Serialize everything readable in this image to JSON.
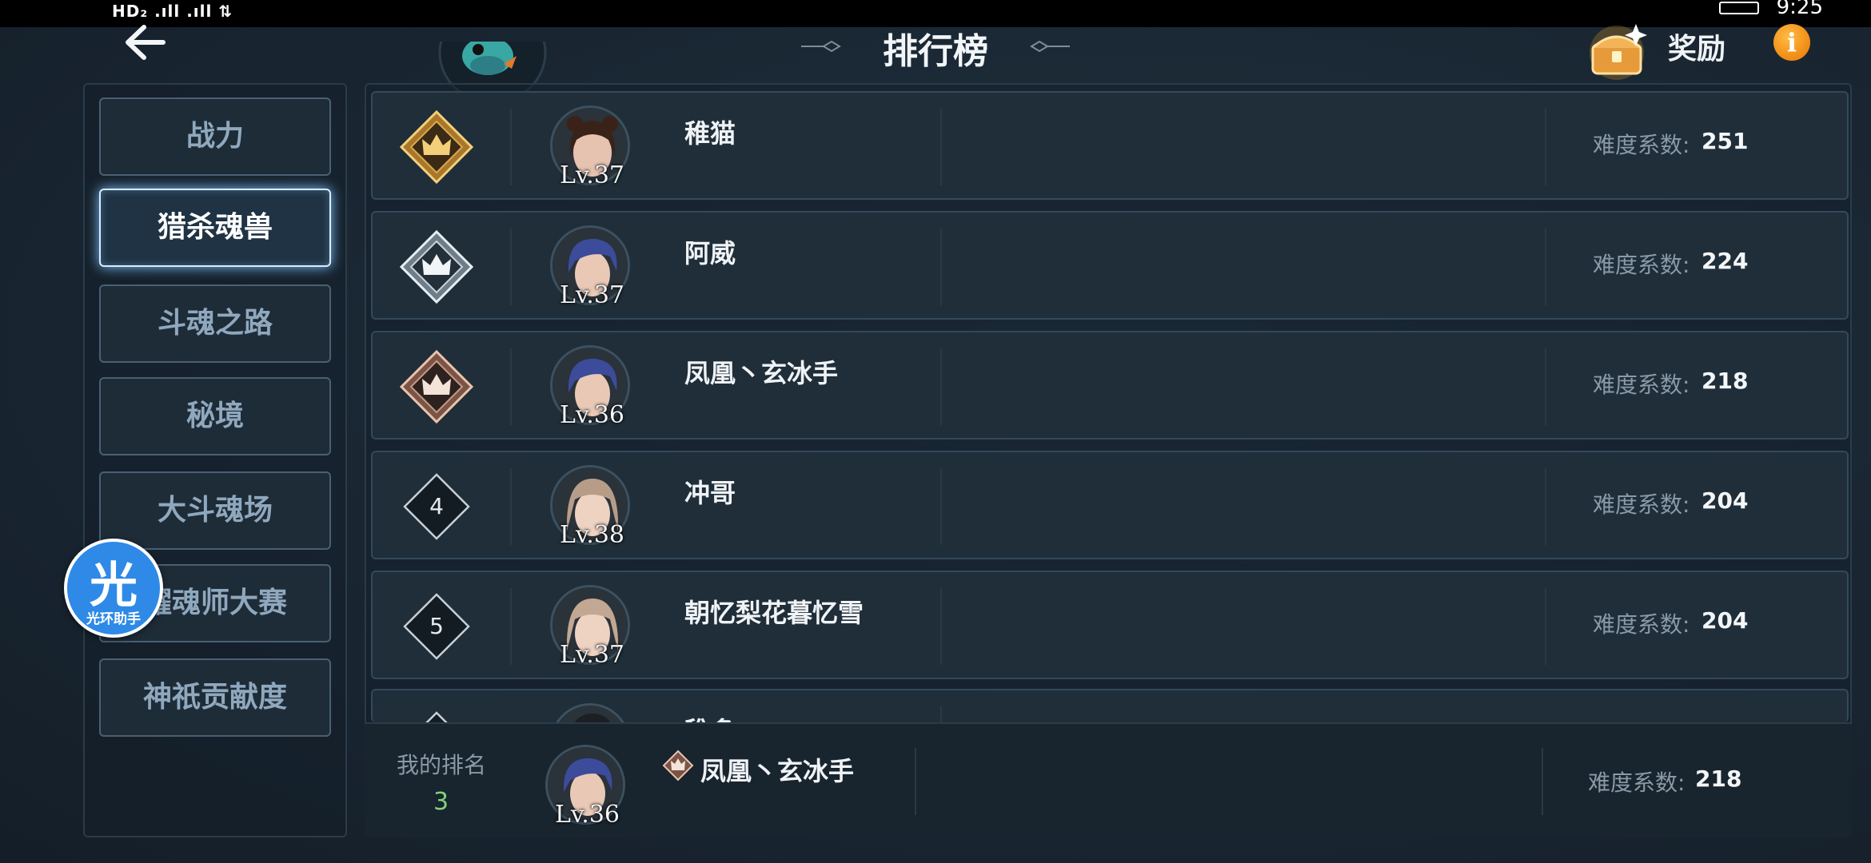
{
  "status_bar": {
    "left_text": "HD₂ .ıll .ıll ⇅",
    "time": "9:25"
  },
  "header": {
    "title": "排行榜",
    "reward_label": "奖励",
    "info_label": "i"
  },
  "sidebar": {
    "items": [
      {
        "label": "战力"
      },
      {
        "label": "猎杀魂兽",
        "active": true
      },
      {
        "label": "斗魂之路"
      },
      {
        "label": "秘境"
      },
      {
        "label": "大斗魂场"
      },
      {
        "label": "耀魂师大赛"
      },
      {
        "label": "神祇贡献度"
      }
    ]
  },
  "assistant": {
    "glyph": "光",
    "label": "光环助手"
  },
  "score_prefix": "难度系数:",
  "ranking": [
    {
      "rank": 1,
      "medal": "gold",
      "name": "稚猫",
      "level": "Lv.37",
      "score": "251"
    },
    {
      "rank": 2,
      "medal": "silver",
      "name": "阿威",
      "level": "Lv.37",
      "score": "224"
    },
    {
      "rank": 3,
      "medal": "bronze",
      "name": "凤凰丶玄冰手",
      "level": "Lv.36",
      "score": "218"
    },
    {
      "rank": "4",
      "medal": "plain",
      "name": "冲哥",
      "level": "Lv.38",
      "score": "204"
    },
    {
      "rank": "5",
      "medal": "plain",
      "name": "朝忆梨花暮忆雪",
      "level": "Lv.37",
      "score": "204"
    },
    {
      "rank": "",
      "medal": "plain",
      "name": "稚多",
      "level": "",
      "score": ""
    }
  ],
  "my_rank": {
    "label": "我的排名",
    "rank": "3",
    "name": "凤凰丶玄冰手",
    "level": "Lv.36",
    "score_label": "难度系数:",
    "score": "218"
  },
  "colors": {
    "gold": "#d9a84a",
    "silver": "#c8d3dc",
    "bronze": "#c49a84",
    "accent_green": "#7ed37a",
    "info_orange": "#f5a21c"
  }
}
